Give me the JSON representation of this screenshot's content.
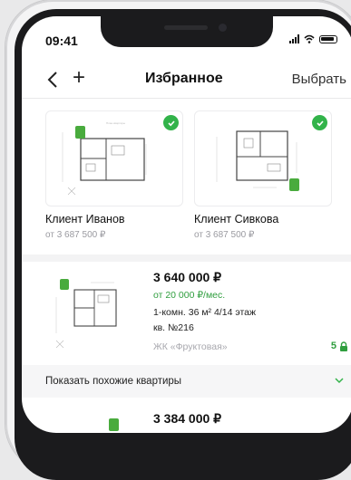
{
  "status_bar": {
    "time": "09:41"
  },
  "header": {
    "title": "Избранное",
    "select_label": "Выбрать"
  },
  "favorites": [
    {
      "client": "Клиент Иванов",
      "price": "от 3 687 500 ₽"
    },
    {
      "client": "Клиент Сивкова",
      "price": "от 3 687 500 ₽"
    }
  ],
  "apartment": {
    "price": "3 640 000 ₽",
    "monthly": "от 20 000 ₽/мес.",
    "details": "1-комн.   36 м²   4/14 этаж",
    "number": "кв. №216",
    "complex": "ЖК «Фруктовая»",
    "count": "5"
  },
  "similar": {
    "label": "Показать похожие квартиры"
  },
  "next_apartment": {
    "price": "3 384 000 ₽"
  },
  "colors": {
    "accent_green": "#32b34a",
    "text": "#111111",
    "muted": "#9a9aa0"
  }
}
